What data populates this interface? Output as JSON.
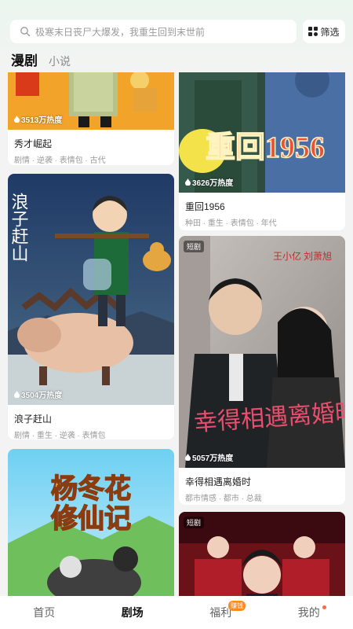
{
  "search": {
    "placeholder": "极寒末日丧尸大爆发，我重生回到末世前"
  },
  "filter": {
    "label": "筛选",
    "icon": "grid-icon"
  },
  "tabs": [
    {
      "label": "漫剧",
      "active": true
    },
    {
      "label": "小说",
      "active": false
    }
  ],
  "feed": {
    "left": [
      {
        "title": "秀才崛起",
        "tags": "剧情 · 逆袭 · 表情包 · 古代",
        "heat": "3513万热度",
        "badge": ""
      },
      {
        "title": "浪子赶山",
        "tags": "剧情 · 重生 · 逆袭 · 表情包",
        "heat": "3504万热度",
        "badge": "",
        "cover_text": "浪子赶山"
      },
      {
        "title": "",
        "tags": "",
        "heat": "",
        "badge": "",
        "cover_text": "杨冬花修仙记"
      }
    ],
    "right": [
      {
        "title": "重回1956",
        "tags": "种田 · 重生 · 表情包 · 年代",
        "heat": "3626万热度",
        "badge": "",
        "cover_text": "重回1956"
      },
      {
        "title": "幸得相遇离婚时",
        "tags": "都市情感 · 都市 · 总裁",
        "heat": "5057万热度",
        "badge": "短剧",
        "cover_text": "幸得相遇离婚时",
        "cover_small": "王小亿 刘萧旭"
      },
      {
        "title": "",
        "tags": "",
        "heat": "",
        "badge": "短剧"
      }
    ]
  },
  "bottom_nav": [
    {
      "label": "首页",
      "active": false
    },
    {
      "label": "剧场",
      "active": true
    },
    {
      "label": "福利",
      "active": false,
      "badge": "赚钱"
    },
    {
      "label": "我的",
      "active": false,
      "dot": true
    }
  ],
  "colors": {
    "accent_orange": "#ff8a1f",
    "active_text": "#111111",
    "inactive_text": "#666666"
  }
}
